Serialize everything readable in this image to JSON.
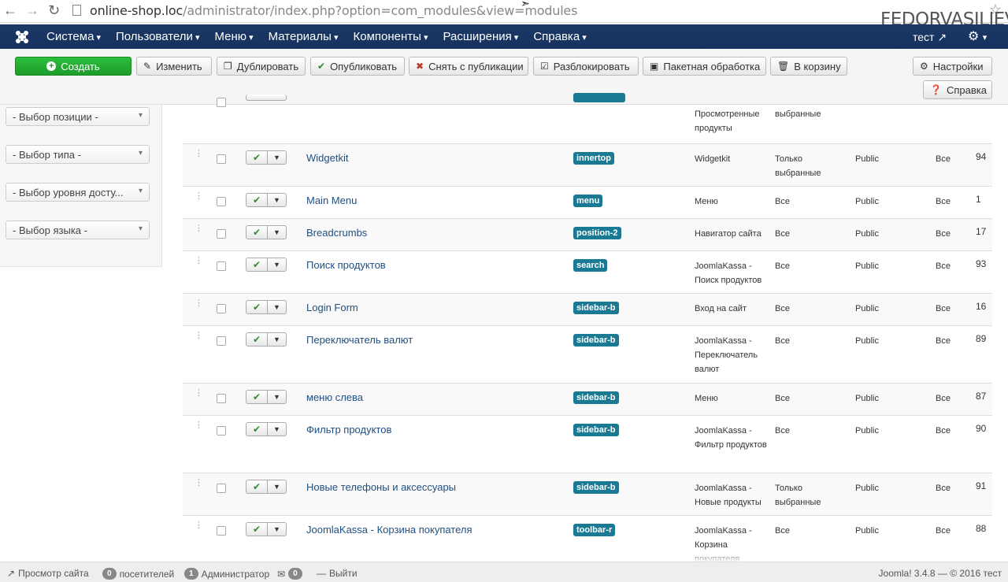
{
  "browser": {
    "url_host": "online-shop.loc",
    "url_path": "/administrator/index.php?option=com_modules&view=modules",
    "watermark": "FEDORVASILIEV.RU"
  },
  "navbar": {
    "items": [
      "Система",
      "Пользователи",
      "Меню",
      "Материалы",
      "Компоненты",
      "Расширения",
      "Справка"
    ],
    "user": "тест",
    "colors": {
      "bg": "#1a3867"
    }
  },
  "toolbar": {
    "create": "Создать",
    "edit": "Изменить",
    "duplicate": "Дублировать",
    "publish": "Опубликовать",
    "unpublish": "Снять с публикации",
    "checkin": "Разблокировать",
    "batch": "Пакетная обработка",
    "trash": "В корзину",
    "options": "Настройки",
    "help": "Справка"
  },
  "filters": {
    "position": "- Выбор позиции -",
    "type": "- Выбор типа -",
    "access": "- Выбор уровня досту...",
    "language": "- Выбор языка -"
  },
  "table": {
    "partial_row": {
      "type": "Просмотренные продукты",
      "pages": "выбранные"
    },
    "rows": [
      {
        "title": "Widgetkit",
        "position": "innertop",
        "type": "Widgetkit",
        "pages": "Только выбранные",
        "access": "Public",
        "language": "Все",
        "id": "94"
      },
      {
        "title": "Main Menu",
        "position": "menu",
        "type": "Меню",
        "pages": "Все",
        "access": "Public",
        "language": "Все",
        "id": "1"
      },
      {
        "title": "Breadcrumbs",
        "position": "position-2",
        "type": "Навигатор сайта",
        "pages": "Все",
        "access": "Public",
        "language": "Все",
        "id": "17"
      },
      {
        "title": "Поиск продуктов",
        "position": "search",
        "type": "JoomlaKassa - Поиск продуктов",
        "pages": "Все",
        "access": "Public",
        "language": "Все",
        "id": "93"
      },
      {
        "title": "Login Form",
        "position": "sidebar-b",
        "type": "Вход на сайт",
        "pages": "Все",
        "access": "Public",
        "language": "Все",
        "id": "16"
      },
      {
        "title": "Переключатель валют",
        "position": "sidebar-b",
        "type": "JoomlaKassa - Переключатель валют",
        "pages": "Все",
        "access": "Public",
        "language": "Все",
        "id": "89"
      },
      {
        "title": "меню слева",
        "position": "sidebar-b",
        "type": "Меню",
        "pages": "Все",
        "access": "Public",
        "language": "Все",
        "id": "87"
      },
      {
        "title": "Фильтр продуктов",
        "position": "sidebar-b",
        "type": "JoomlaKassa - Фильтр продуктов",
        "pages": "Все",
        "access": "Public",
        "language": "Все",
        "id": "90"
      },
      {
        "title": "Новые телефоны и аксессуары",
        "position": "sidebar-b",
        "type": "JoomlaKassa - Новые продукты",
        "pages": "Только выбранные",
        "access": "Public",
        "language": "Все",
        "id": "91"
      },
      {
        "title": "JoomlaKassa - Корзина покупателя",
        "position": "toolbar-r",
        "type": "JoomlaKassa - Корзина покупателя",
        "pages": "Все",
        "access": "Public",
        "language": "Все",
        "id": "88"
      }
    ]
  },
  "statusbar": {
    "view_site": "Просмотр сайта",
    "visitors_count": "0",
    "visitors": "посетителей",
    "admin_count": "1",
    "admin": "Администратор",
    "messages_count": "0",
    "logout": "Выйти",
    "version": "Joomla! 3.4.8 — © 2016 тест"
  }
}
